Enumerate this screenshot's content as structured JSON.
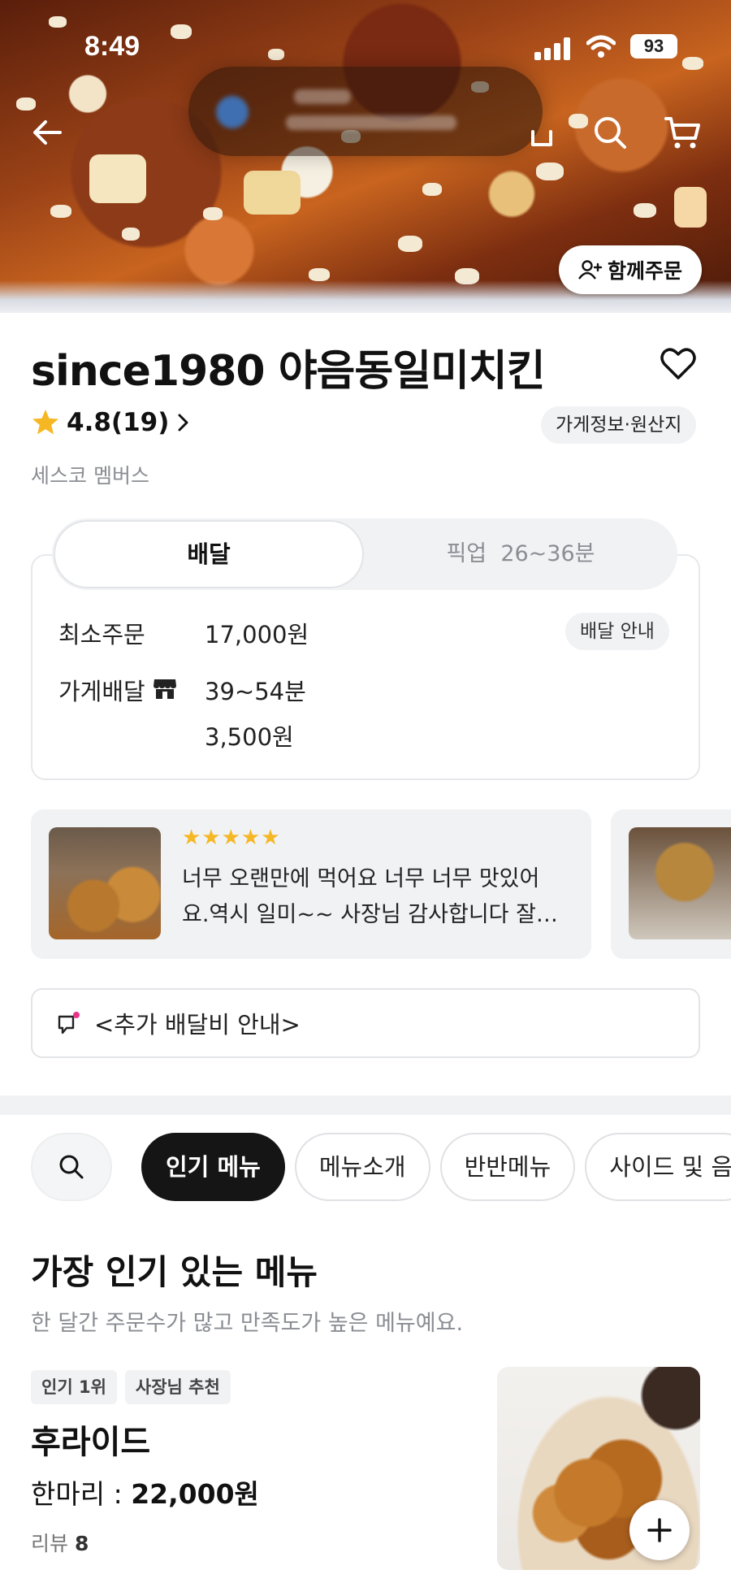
{
  "status_bar": {
    "time": "8:49",
    "battery": "93"
  },
  "hero": {
    "together_order_label": "함께주문"
  },
  "store": {
    "name": "since1980 야음동일미치킨",
    "rating": "4.8(19)",
    "info_chip": "가게정보·원산지",
    "membership": "세스코 멤버스"
  },
  "delivery": {
    "tab_delivery": "배달",
    "tab_pickup": "픽업",
    "pickup_time": "26~36분",
    "min_order_label": "최소주문",
    "min_order_value": "17,000원",
    "guide_chip": "배달 안내",
    "store_delivery_label": "가게배달",
    "delivery_time": "39~54분",
    "delivery_fee": "3,500원"
  },
  "reviews": [
    {
      "stars": "★★★★★",
      "text_line1": "너무 오랜만에 먹어요 너무 너무 맛있어",
      "text_line2": "요.역시 일미~~ 사장님 감사합니다 잘…"
    }
  ],
  "notice": {
    "text": "<추가 배달비 안내>"
  },
  "categories": [
    "인기 메뉴",
    "메뉴소개",
    "반반메뉴",
    "사이드 및 음"
  ],
  "section": {
    "title": "가장 인기 있는 메뉴",
    "subtitle": "한 달간 주문수가 많고 만족도가 높은 메뉴예요."
  },
  "menu_item": {
    "badges": [
      "인기 1위",
      "사장님 추천"
    ],
    "name": "후라이드",
    "price_label": "한마리 : ",
    "price": "22,000원",
    "review_label": "리뷰 ",
    "review_count": "8"
  },
  "colors": {
    "star": "#F5B723",
    "active_chip": "#151515",
    "muted_text": "#8A8D93"
  }
}
